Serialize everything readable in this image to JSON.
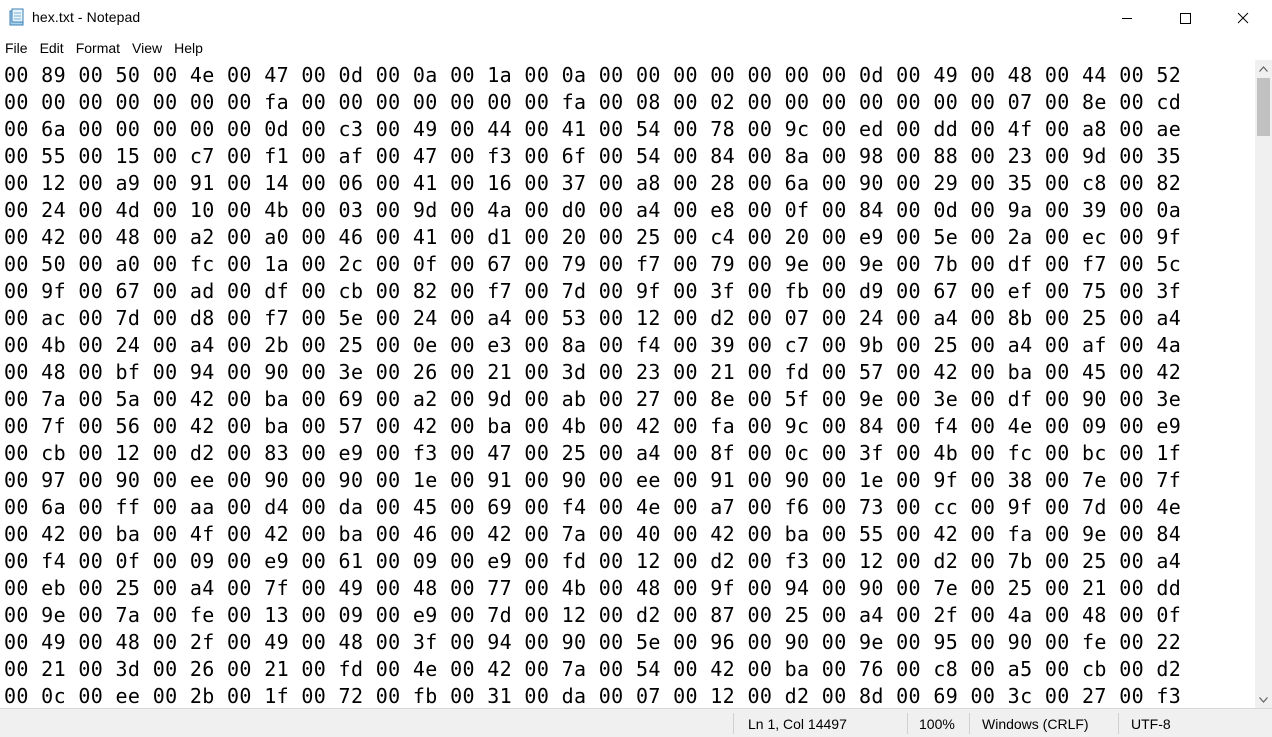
{
  "window": {
    "title": "hex.txt - Notepad",
    "app_icon": "notepad-icon",
    "controls": [
      "minimize-icon",
      "maximize-icon",
      "close-icon"
    ]
  },
  "menu": [
    {
      "label": "File"
    },
    {
      "label": "Edit"
    },
    {
      "label": "Format"
    },
    {
      "label": "View"
    },
    {
      "label": "Help"
    }
  ],
  "editor": {
    "lines": [
      "00 89 00 50 00 4e 00 47 00 0d 00 0a 00 1a 00 0a 00 00 00 00 00 00 00 0d 00 49 00 48 00 44 00 52",
      "00 00 00 00 00 00 00 fa 00 00 00 00 00 00 00 fa 00 08 00 02 00 00 00 00 00 00 00 07 00 8e 00 cd",
      "00 6a 00 00 00 00 00 0d 00 c3 00 49 00 44 00 41 00 54 00 78 00 9c 00 ed 00 dd 00 4f 00 a8 00 ae",
      "00 55 00 15 00 c7 00 f1 00 af 00 47 00 f3 00 6f 00 54 00 84 00 8a 00 98 00 88 00 23 00 9d 00 35",
      "00 12 00 a9 00 91 00 14 00 06 00 41 00 16 00 37 00 a8 00 28 00 6a 00 90 00 29 00 35 00 c8 00 82",
      "00 24 00 4d 00 10 00 4b 00 03 00 9d 00 4a 00 d0 00 a4 00 e8 00 0f 00 84 00 0d 00 9a 00 39 00 0a",
      "00 42 00 48 00 a2 00 a0 00 46 00 41 00 d1 00 20 00 25 00 c4 00 20 00 e9 00 5e 00 2a 00 ec 00 9f",
      "00 50 00 a0 00 fc 00 1a 00 2c 00 0f 00 67 00 79 00 f7 00 79 00 9e 00 9e 00 7b 00 df 00 f7 00 5c",
      "00 9f 00 67 00 ad 00 df 00 cb 00 82 00 f7 00 7d 00 9f 00 3f 00 fb 00 d9 00 67 00 ef 00 75 00 3f",
      "00 ac 00 7d 00 d8 00 f7 00 5e 00 24 00 a4 00 53 00 12 00 d2 00 07 00 24 00 a4 00 8b 00 25 00 a4",
      "00 4b 00 24 00 a4 00 2b 00 25 00 0e 00 e3 00 8a 00 f4 00 39 00 c7 00 9b 00 25 00 a4 00 af 00 4a",
      "00 48 00 bf 00 94 00 90 00 3e 00 26 00 21 00 3d 00 23 00 21 00 fd 00 57 00 42 00 ba 00 45 00 42",
      "00 7a 00 5a 00 42 00 ba 00 69 00 a2 00 9d 00 ab 00 27 00 8e 00 5f 00 9e 00 3e 00 df 00 90 00 3e",
      "00 7f 00 56 00 42 00 ba 00 57 00 42 00 ba 00 4b 00 42 00 fa 00 9c 00 84 00 f4 00 4e 00 09 00 e9",
      "00 cb 00 12 00 d2 00 83 00 e9 00 f3 00 47 00 25 00 a4 00 8f 00 0c 00 3f 00 4b 00 fc 00 bc 00 1f",
      "00 97 00 90 00 ee 00 90 00 90 00 1e 00 91 00 90 00 ee 00 91 00 90 00 1e 00 9f 00 38 00 7e 00 7f",
      "00 6a 00 ff 00 aa 00 d4 00 da 00 45 00 69 00 f4 00 4e 00 a7 00 f6 00 73 00 cc 00 9f 00 7d 00 4e",
      "00 42 00 ba 00 4f 00 42 00 ba 00 46 00 42 00 7a 00 40 00 42 00 ba 00 55 00 42 00 fa 00 9e 00 84",
      "00 f4 00 0f 00 09 00 e9 00 61 00 09 00 e9 00 fd 00 12 00 d2 00 f3 00 12 00 d2 00 7b 00 25 00 a4",
      "00 eb 00 25 00 a4 00 7f 00 49 00 48 00 77 00 4b 00 48 00 9f 00 94 00 90 00 7e 00 25 00 21 00 dd",
      "00 9e 00 7a 00 fe 00 13 00 09 00 e9 00 7d 00 12 00 d2 00 87 00 25 00 a4 00 2f 00 4a 00 48 00 0f",
      "00 49 00 48 00 2f 00 49 00 48 00 3f 00 94 00 90 00 5e 00 96 00 90 00 9e 00 95 00 90 00 fe 00 22",
      "00 21 00 3d 00 26 00 21 00 fd 00 4e 00 42 00 7a 00 54 00 42 00 ba 00 76 00 c8 00 a5 00 cb 00 d2",
      "00 0c 00 ee 00 2b 00 1f 00 72 00 fb 00 31 00 da 00 07 00 12 00 d2 00 8d 00 69 00 3c 00 27 00 f3"
    ]
  },
  "scrollbar": {
    "up_icon": "scroll-up-arrow-icon",
    "down_icon": "scroll-down-arrow-icon"
  },
  "status": {
    "position": "Ln 1, Col 14497",
    "zoom": "100%",
    "line_ending": "Windows (CRLF)",
    "encoding": "UTF-8"
  },
  "colors": {
    "background": "#ffffff",
    "statusbar": "#f0f0f0",
    "scrollbar_track": "#f0f0f0",
    "scrollbar_thumb": "#c1c1c1"
  }
}
